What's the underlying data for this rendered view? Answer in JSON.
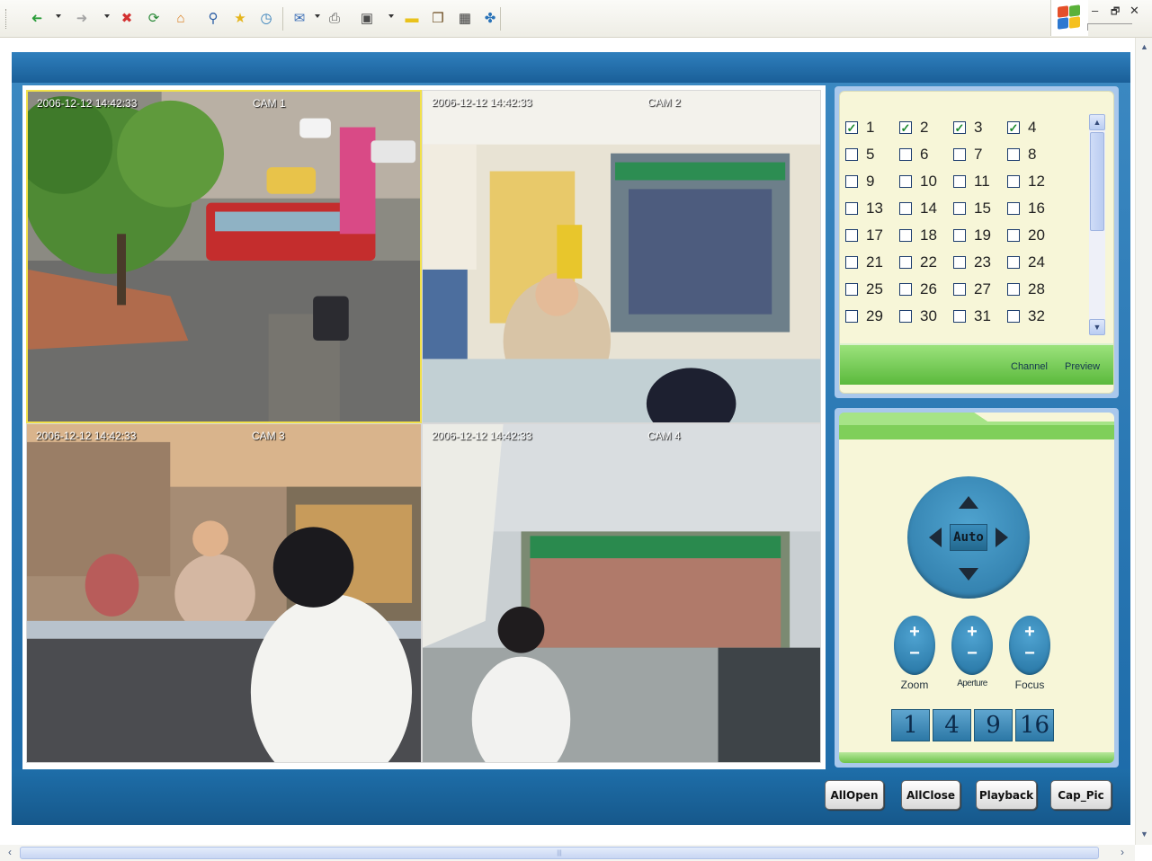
{
  "toolbar": {
    "buttons": [
      {
        "icon": "back-icon",
        "glyph": "➜",
        "color": "#2a9d3a"
      },
      {
        "icon": "forward-icon",
        "glyph": "➜",
        "color": "#a4a4a4"
      },
      {
        "icon": "stop-icon",
        "glyph": "✖",
        "color": "#d33131"
      },
      {
        "icon": "refresh-icon",
        "glyph": "⟳",
        "color": "#2c8a3a"
      },
      {
        "icon": "home-icon",
        "glyph": "⌂",
        "color": "#d87a1a"
      },
      {
        "icon": "search-icon",
        "glyph": "⚲",
        "color": "#2b5ea5"
      },
      {
        "icon": "favorites-icon",
        "glyph": "★",
        "color": "#e5b51b"
      },
      {
        "icon": "history-icon",
        "glyph": "◷",
        "color": "#2e7bb8"
      },
      {
        "icon": "mail-icon",
        "glyph": "✉",
        "color": "#3d6fb7"
      },
      {
        "icon": "print-icon",
        "glyph": "⎙",
        "color": "#555555"
      },
      {
        "icon": "edit-icon",
        "glyph": "▣",
        "color": "#4b4b4b"
      },
      {
        "icon": "discuss-icon",
        "glyph": "▬",
        "color": "#e9c21c"
      },
      {
        "icon": "research-icon",
        "glyph": "❒",
        "color": "#6b4a1e"
      },
      {
        "icon": "messenger-icon",
        "glyph": "▦",
        "color": "#3b3b3b"
      },
      {
        "icon": "bluetooth-icon",
        "glyph": "✤",
        "color": "#2a73b8"
      }
    ],
    "window_controls": {
      "minimize": "–",
      "restore": "🗗",
      "close": "✕"
    }
  },
  "cameras": [
    {
      "timestamp": "2006-12-12 14:42:33",
      "name": "CAM 1",
      "selected": true
    },
    {
      "timestamp": "2006-12-12 14:42:33",
      "name": "CAM 2",
      "selected": false
    },
    {
      "timestamp": "2006-12-12 14:42:33",
      "name": "CAM 3",
      "selected": false
    },
    {
      "timestamp": "2006-12-12 14:42:33",
      "name": "CAM 4",
      "selected": false
    }
  ],
  "channels": {
    "numbers": [
      1,
      2,
      3,
      4,
      5,
      6,
      7,
      8,
      9,
      10,
      11,
      12,
      13,
      14,
      15,
      16,
      17,
      18,
      19,
      20,
      21,
      22,
      23,
      24,
      25,
      26,
      27,
      28,
      29,
      30,
      31,
      32
    ],
    "checked": [
      1,
      2,
      3,
      4
    ],
    "channel_button": "Channel",
    "preview_button": "Preview"
  },
  "ptz": {
    "auto_label": "Auto",
    "lens_controls": [
      {
        "label": "Zoom"
      },
      {
        "label": "Aperture"
      },
      {
        "label": "Focus"
      }
    ],
    "layout_buttons": [
      "1",
      "4",
      "9",
      "16"
    ]
  },
  "buttons": {
    "all_open": "AllOpen",
    "all_close": "AllClose",
    "playback": "Playback",
    "cap_pic": "Cap_Pic"
  }
}
